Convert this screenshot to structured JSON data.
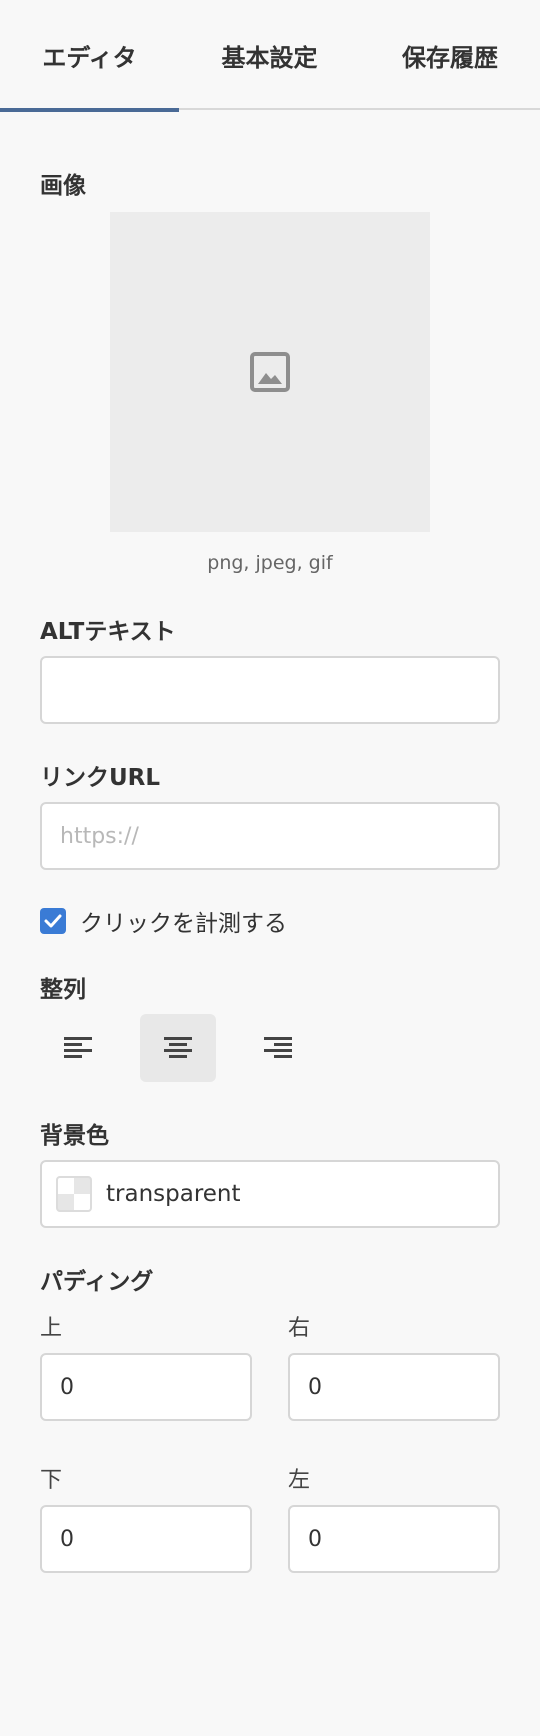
{
  "tabs": [
    {
      "label": "エディタ",
      "active": true
    },
    {
      "label": "基本設定",
      "active": false
    },
    {
      "label": "保存履歴",
      "active": false
    }
  ],
  "image_section": {
    "label": "画像",
    "placeholder_icon": "image-icon",
    "hint": "png, jpeg, gif"
  },
  "alt_text": {
    "label": "ALTテキスト",
    "value": "",
    "placeholder": ""
  },
  "link_url": {
    "label": "リンクURL",
    "value": "",
    "placeholder": "https://"
  },
  "track_click": {
    "label": "クリックを計測する",
    "checked": true
  },
  "alignment": {
    "label": "整列",
    "options": [
      {
        "icon": "align-left-icon",
        "active": false
      },
      {
        "icon": "align-center-icon",
        "active": true
      },
      {
        "icon": "align-right-icon",
        "active": false
      }
    ]
  },
  "background_color": {
    "label": "背景色",
    "value": "transparent"
  },
  "padding": {
    "label": "パディング",
    "top_label": "上",
    "top_value": "0",
    "right_label": "右",
    "right_value": "0",
    "bottom_label": "下",
    "bottom_value": "0",
    "left_label": "左",
    "left_value": "0"
  },
  "colors": {
    "accent": "#4a6a96",
    "checkbox": "#3a7bd5",
    "background": "#f8f8f8"
  }
}
